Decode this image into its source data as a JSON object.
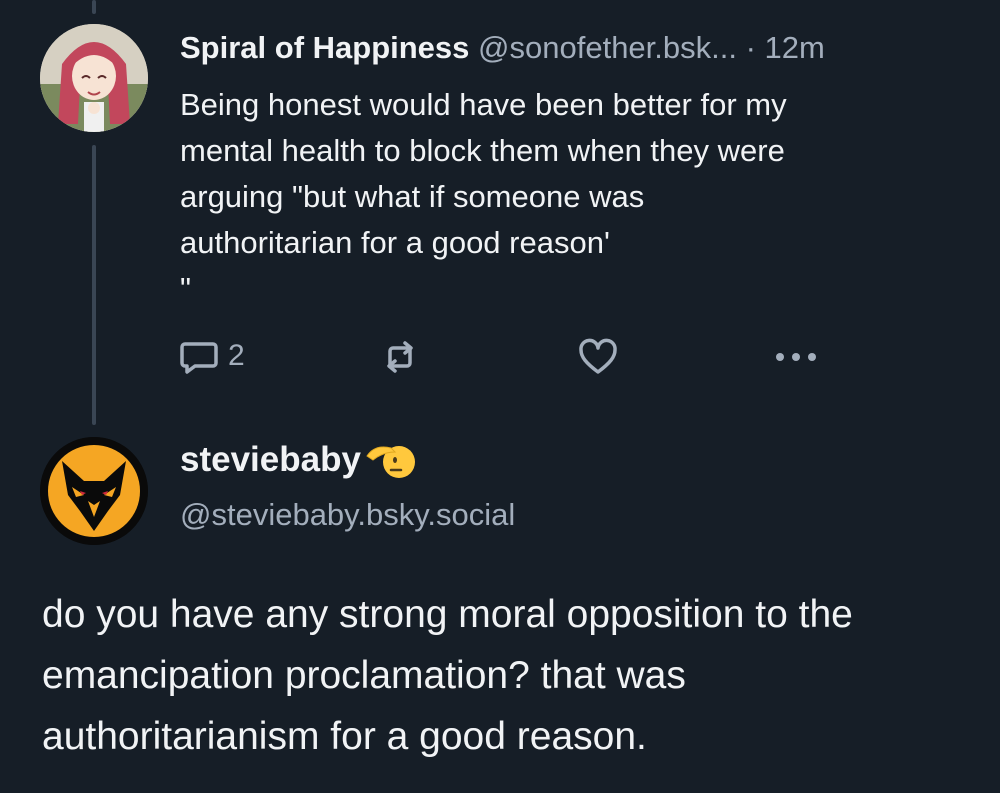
{
  "post1": {
    "display_name": "Spiral of Happiness",
    "handle": "@sonofether.bsk...",
    "time": "· 12m",
    "body": "Being honest would have been better for my\nmental health to block them when they were\narguing \"but what if someone was\nauthoritarian for a good reason'\n\"",
    "reply_count": "2"
  },
  "post2": {
    "display_name": "steviebaby",
    "handle": "@steviebaby.bsky.social",
    "body": "do you have any strong moral opposition to the emancipation proclamation? that was authoritarianism for a good reason."
  },
  "icons": [
    "reply-icon",
    "repost-icon",
    "like-icon",
    "more-icon",
    "saluting-face-icon"
  ],
  "colors": {
    "background": "#161e27",
    "text": "#f1f3f5",
    "muted": "#a3aebc",
    "thread_line": "#3a4654",
    "wolf_orange": "#f5a623"
  }
}
